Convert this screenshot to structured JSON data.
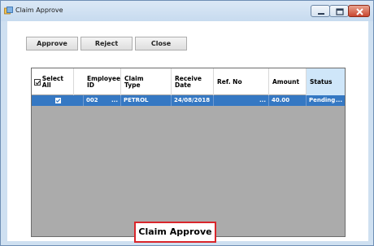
{
  "window": {
    "title": "Claim Approve",
    "icon": "app-icon",
    "controls": [
      "minimize-icon",
      "maximize-icon",
      "close-icon"
    ]
  },
  "toolbar": {
    "approve_label": "Approve",
    "reject_label": "Reject",
    "close_label": "Close"
  },
  "grid": {
    "select_all_label": "Select All",
    "columns": [
      {
        "label": "Select All"
      },
      {
        "label": "Employee\nID"
      },
      {
        "label": "Claim\nType"
      },
      {
        "label": "Receive\nDate"
      },
      {
        "label": "Ref. No"
      },
      {
        "label": "Amount"
      },
      {
        "label": "Status"
      }
    ],
    "rows": [
      {
        "selected": true,
        "employee_id": "002",
        "claim_type": "PETROL",
        "receive_date": "24/08/2018",
        "ref_no": "",
        "amount": "40.00",
        "status": "Pending"
      }
    ],
    "ellipsis": "...",
    "selection_color": "#3578c3",
    "empty_area_color": "#ababab",
    "status_header_color": "#cfe6f9"
  },
  "caption": {
    "text": "Claim Approve",
    "border_color": "#d9262b"
  }
}
